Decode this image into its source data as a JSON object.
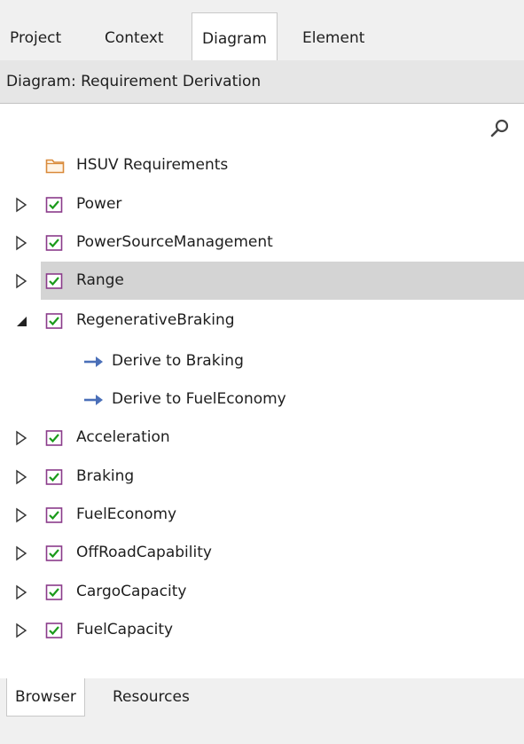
{
  "top_tabs": [
    "Project",
    "Context",
    "Diagram",
    "Element"
  ],
  "active_top_tab": "Diagram",
  "header": {
    "title": "Diagram: Requirement Derivation"
  },
  "tree": {
    "root": "HSUV Requirements",
    "items": [
      "Power",
      "PowerSourceManagement",
      "Range",
      "RegenerativeBraking",
      "Derive to Braking",
      "Derive to FuelEconomy",
      "Acceleration",
      "Braking",
      "FuelEconomy",
      "OffRoadCapability",
      "CargoCapacity",
      "FuelCapacity"
    ],
    "selected_item": "Range",
    "expanded_item": "RegenerativeBraking"
  },
  "bottom_tabs": [
    "Browser",
    "Resources"
  ],
  "active_bottom_tab": "Browser",
  "colors": {
    "tab_bar_bg": "#f0f0f0",
    "header_bg": "#e6e6e6",
    "selection_bg": "#d4d4d4",
    "folder_orange": "#d98a3a",
    "requirement_border": "#8a3b8a",
    "check_green": "#1a9a1a",
    "arrow_blue": "#4a6fb8"
  },
  "icons": {
    "folder": "folder-icon",
    "requirement": "requirement-check-icon",
    "derive": "derive-arrow-icon",
    "search": "search-icon",
    "collapsed": "triangle-right-icon",
    "expanded": "triangle-down-icon"
  }
}
